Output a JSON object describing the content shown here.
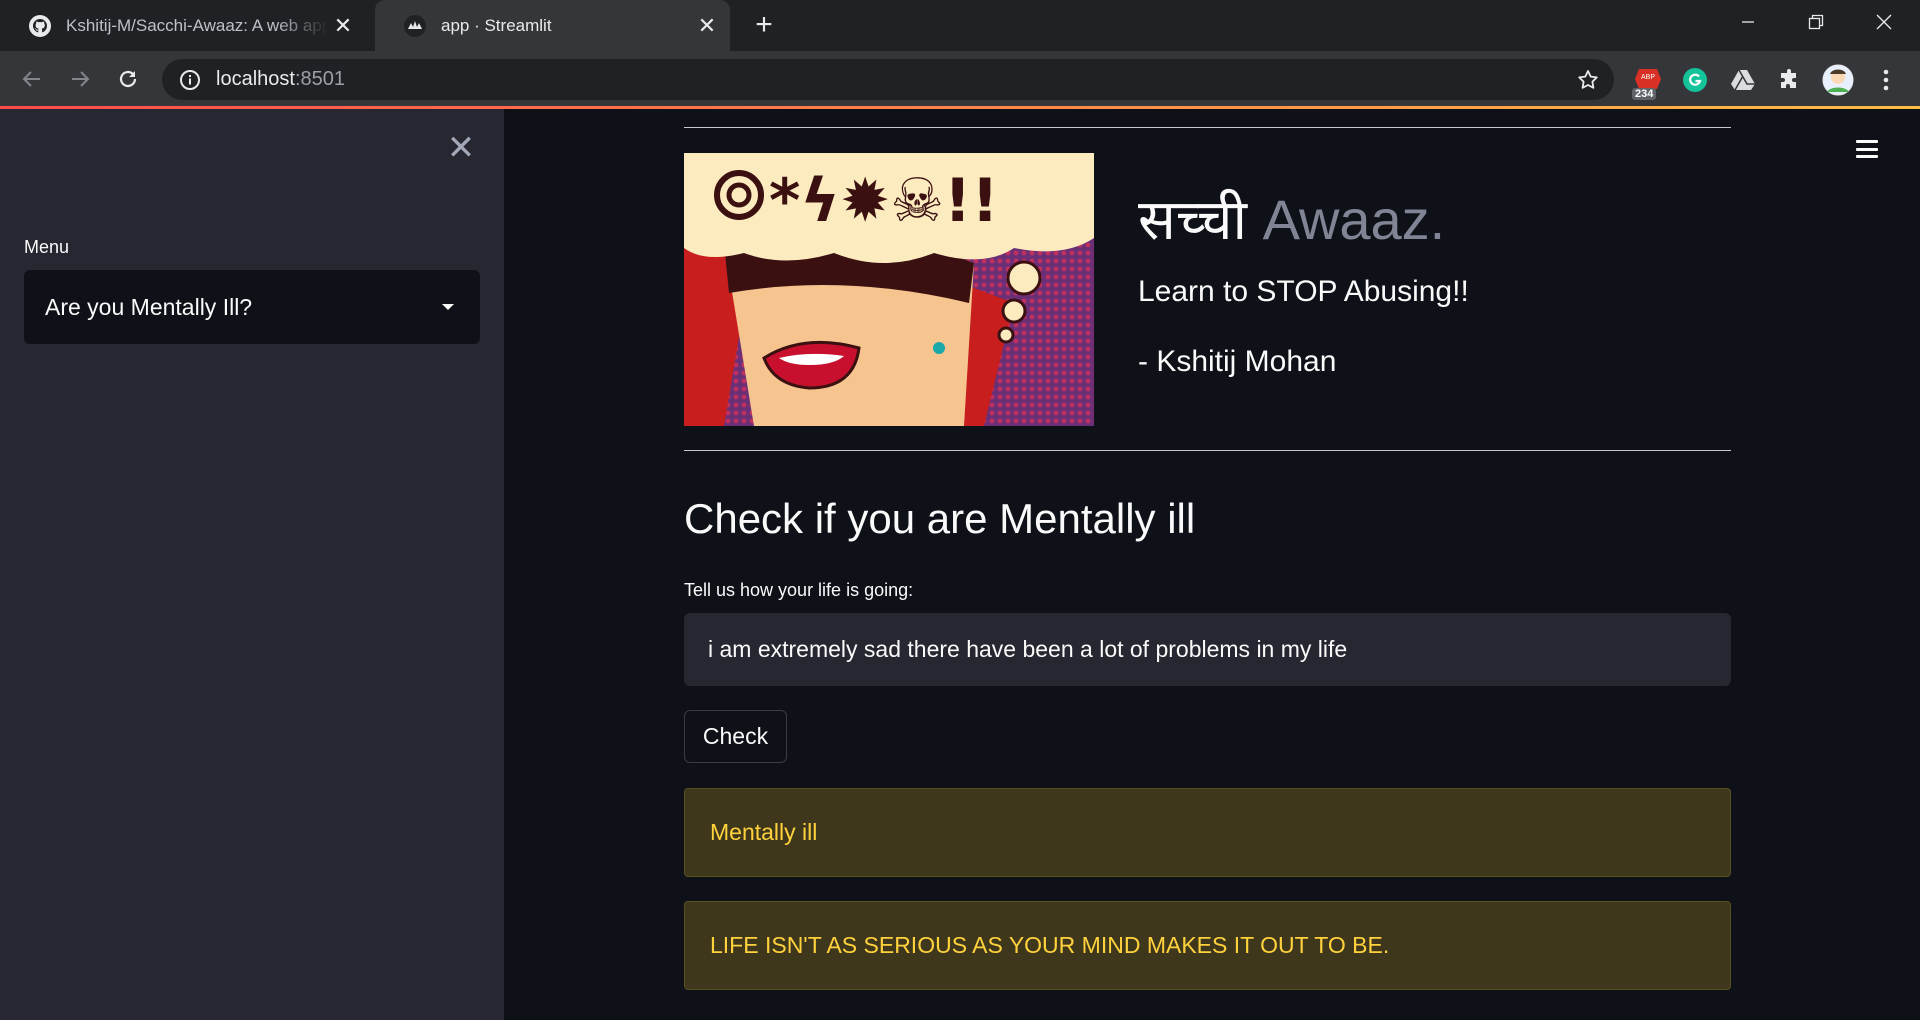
{
  "browser": {
    "tabs": [
      {
        "title": "Kshitij-M/Sacchi-Awaaz: A web app",
        "icon": "github-icon"
      },
      {
        "title": "app · Streamlit",
        "icon": "streamlit-icon"
      }
    ],
    "url_host": "localhost",
    "url_port": ":8501",
    "extension_badge": "234"
  },
  "sidebar": {
    "menu_label": "Menu",
    "selected_option": "Are you Mentally Ill?"
  },
  "header": {
    "title_hindi": "सच्ची",
    "title_english": " Awaaz.",
    "subtitle": "Learn to STOP Abusing!!",
    "author": "- Kshitij Mohan"
  },
  "main": {
    "heading": "Check if you are Mentally ill",
    "input_label": "Tell us how your life is going:",
    "input_value": "i am extremely sad there have been a lot of problems in my life",
    "check_button": "Check",
    "result": "Mentally ill",
    "quote": "LIFE ISN'T AS SERIOUS AS YOUR MIND MAKES IT OUT TO BE."
  },
  "colors": {
    "accent_start": "#ff4b4b",
    "accent_end": "#ffbd45",
    "warning_text": "#ffd23d"
  }
}
